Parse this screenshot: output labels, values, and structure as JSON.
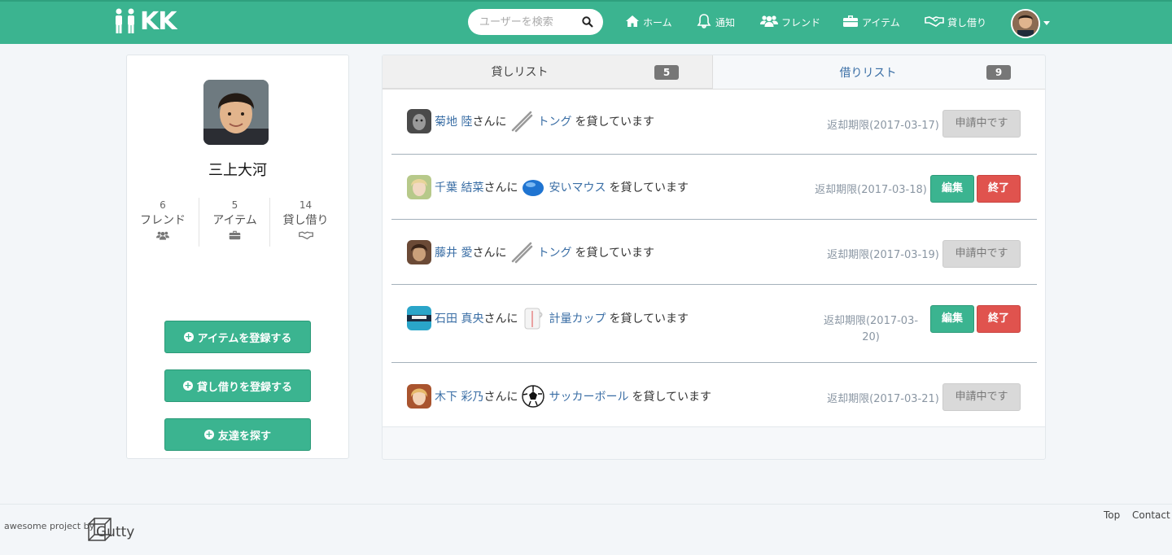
{
  "app": {
    "logo_text": "KK"
  },
  "nav": {
    "search_placeholder": "ユーザーを検索",
    "home": "ホーム",
    "notifications": "通知",
    "friends": "フレンド",
    "items": "アイテム",
    "lending": "貸し借り"
  },
  "profile": {
    "name": "三上大河",
    "stats": [
      {
        "count": "6",
        "label": "フレンド",
        "icon": "users-icon"
      },
      {
        "count": "5",
        "label": "アイテム",
        "icon": "briefcase-icon"
      },
      {
        "count": "14",
        "label": "貸し借り",
        "icon": "handshake-icon"
      }
    ],
    "buttons": {
      "register_item": "アイテムを登録する",
      "register_lending": "貸し借りを登録する",
      "find_friends": "友達を探す"
    }
  },
  "tabs": {
    "lend": {
      "label": "貸しリスト",
      "count": "5"
    },
    "borrow": {
      "label": "借りリスト",
      "count": "9"
    }
  },
  "lend_list": [
    {
      "user": "菊地 陸",
      "suffix": "さんに",
      "item": "トング",
      "action": "を貸しています",
      "due": "返却期限(2017-03-17)",
      "status": "pending",
      "pending_label": "申請中です",
      "item_icon": "tongs-icon",
      "avatar_color": "#555"
    },
    {
      "user": "千葉 結菜",
      "suffix": "さんに",
      "item": "安いマウス",
      "action": "を貸しています",
      "due": "返却期限(2017-03-18)",
      "status": "active",
      "edit_label": "編集",
      "end_label": "終了",
      "item_icon": "mouse-icon",
      "avatar_color": "#b7c98a"
    },
    {
      "user": "藤井 愛",
      "suffix": "さんに",
      "item": "トング",
      "action": "を貸しています",
      "due": "返却期限(2017-03-19)",
      "status": "pending",
      "pending_label": "申請中です",
      "item_icon": "tongs-icon",
      "avatar_color": "#6b4a36"
    },
    {
      "user": "石田 真央",
      "suffix": "さんに",
      "item": "計量カップ",
      "action": "を貸しています",
      "due": "返却期限(2017-03-20)",
      "status": "active",
      "edit_label": "編集",
      "end_label": "終了",
      "item_icon": "measuring-cup-icon",
      "avatar_color": "#2aa5c9"
    },
    {
      "user": "木下 彩乃",
      "suffix": "さんに",
      "item": "サッカーボール",
      "action": "を貸しています",
      "due": "返却期限(2017-03-21)",
      "status": "pending",
      "pending_label": "申請中です",
      "item_icon": "soccer-ball-icon",
      "avatar_color": "#d9a36a"
    }
  ],
  "footer": {
    "credit": "awesome project by",
    "brand": "Gutty",
    "top": "Top",
    "contact": "Contact"
  },
  "colors": {
    "brand": "#3bb490",
    "danger": "#e0534e",
    "link": "#3a6ea5"
  }
}
